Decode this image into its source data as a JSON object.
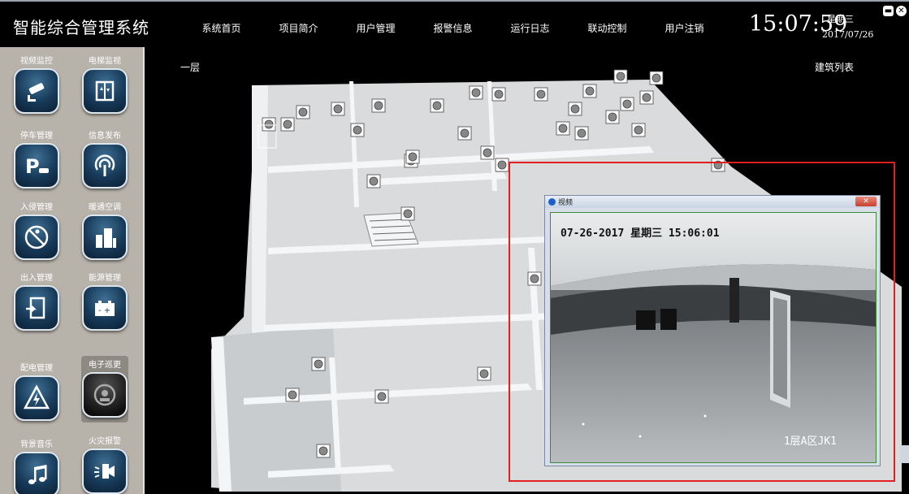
{
  "header": {
    "app_title": "智能综合管理系统",
    "nav": [
      "系统首页",
      "项目简介",
      "用户管理",
      "报警信息",
      "运行日志",
      "联动控制",
      "用户注销"
    ],
    "time": "15:07:59",
    "weekday": "星期三",
    "date": "2017/07/26",
    "window_controls": [
      "minimize-icon",
      "close-icon"
    ]
  },
  "sidebar": {
    "modules": [
      {
        "label": "视频监控",
        "icon": "cctv-camera-icon"
      },
      {
        "label": "电梯监视",
        "icon": "elevator-icon"
      },
      {
        "label": "停车管理",
        "icon": "parking-icon"
      },
      {
        "label": "信息发布",
        "icon": "broadcast-icon"
      },
      {
        "label": "入侵管理",
        "icon": "intrusion-icon"
      },
      {
        "label": "暖通空调",
        "icon": "hvac-building-icon"
      },
      {
        "label": "出入管理",
        "icon": "access-door-icon"
      },
      {
        "label": "能源管理",
        "icon": "battery-icon"
      },
      {
        "label": "配电管理",
        "icon": "lightning-icon"
      },
      {
        "label": "电子巡更",
        "icon": "patrol-icon"
      },
      {
        "label": "背景音乐",
        "icon": "music-note-icon"
      },
      {
        "label": "火灾报警",
        "icon": "fire-alarm-icon"
      }
    ],
    "selected": "电子巡更"
  },
  "main": {
    "floor_label": "一层",
    "building_list_label": "建筑列表"
  },
  "video_popup": {
    "title": "视频",
    "close_label": "✕",
    "osd_timestamp": "07-26-2017 星期三 15:06:01",
    "osd_camera": "1层A区JK1"
  },
  "colors": {
    "highlight_frame": "#e02020",
    "sidebar_bg": "#b7b3ab",
    "button_blue": "#173a59"
  }
}
